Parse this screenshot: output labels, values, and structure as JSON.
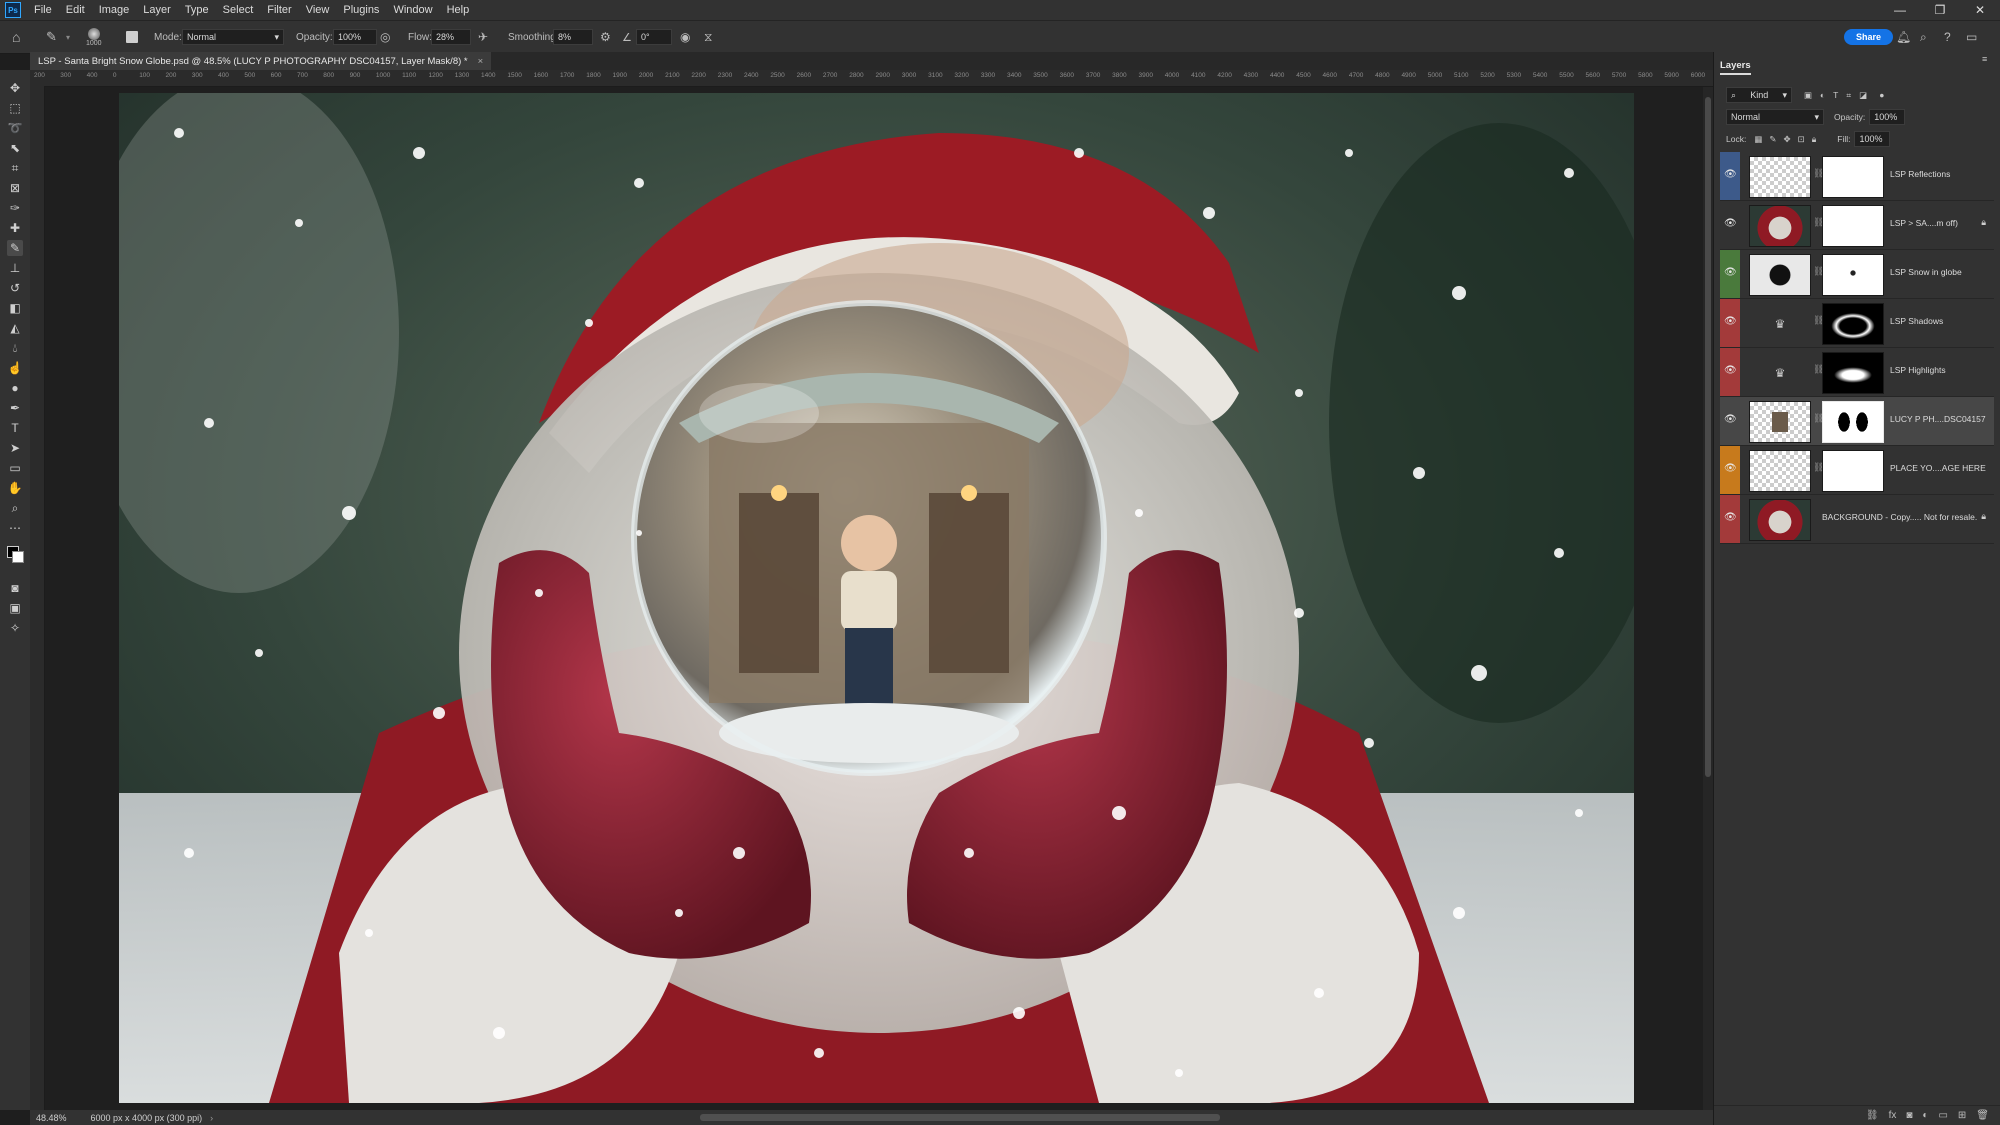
{
  "menu": [
    "File",
    "Edit",
    "Image",
    "Layer",
    "Type",
    "Select",
    "Filter",
    "View",
    "Plugins",
    "Window",
    "Help"
  ],
  "options": {
    "brush_size": "1000",
    "mode_label": "Mode:",
    "mode_value": "Normal",
    "opacity_label": "Opacity:",
    "opacity_value": "100%",
    "flow_label": "Flow:",
    "flow_value": "28%",
    "smoothing_label": "Smoothing:",
    "smoothing_value": "8%",
    "angle_value": "0°",
    "share_label": "Share"
  },
  "document": {
    "tab_title": "LSP - Santa Bright Snow Globe.psd @ 48.5% (LUCY P PHOTOGRAPHY DSC04157, Layer Mask/8) *",
    "close": "×"
  },
  "ruler_numbers": [
    "200",
    "300",
    "400",
    "0",
    "100",
    "200",
    "300",
    "400",
    "500",
    "600",
    "700",
    "800",
    "900",
    "1000",
    "1100",
    "1200",
    "1300",
    "1400",
    "1500",
    "1600",
    "1700",
    "1800",
    "1900",
    "2000",
    "2100",
    "2200",
    "2300",
    "2400",
    "2500",
    "2600",
    "2700",
    "2800",
    "2900",
    "3000",
    "3100",
    "3200",
    "3300",
    "3400",
    "3500",
    "3600",
    "3700",
    "3800",
    "3900",
    "4000",
    "4100",
    "4200",
    "4300",
    "4400",
    "4500",
    "4600",
    "4700",
    "4800",
    "4900",
    "5000",
    "5100",
    "5200",
    "5300",
    "5400",
    "5500",
    "5600",
    "5700",
    "5800",
    "5900",
    "6000"
  ],
  "status": {
    "zoom": "48.48%",
    "doc_info": "6000 px x 4000 px (300 ppi)"
  },
  "layers_panel": {
    "tab": "Layers",
    "filter_label": "Kind",
    "blend_mode": "Normal",
    "opacity_label": "Opacity:",
    "opacity_value": "100%",
    "lock_label": "Lock:",
    "fill_label": "Fill:",
    "fill_value": "100%",
    "layers": [
      {
        "name": "LSP Reflections",
        "color": "#3d5a8a"
      },
      {
        "name": "LSP > SA....m off)",
        "color": ""
      },
      {
        "name": "LSP Snow in globe",
        "color": "#4a7a3c"
      },
      {
        "name": "LSP Shadows",
        "color": "#a33a3a"
      },
      {
        "name": "LSP Highlights",
        "color": "#a33a3a"
      },
      {
        "name": "LUCY P PH....DSC04157",
        "color": ""
      },
      {
        "name": "PLACE YO....AGE HERE",
        "color": "#c77a1c"
      },
      {
        "name": "BACKGROUND - Copy..... Not for resale.",
        "color": "#a33a3a"
      }
    ]
  },
  "colors": {
    "accent": "#1473e6",
    "panel_bg": "#323232",
    "canvas_bg": "#1f1f1f"
  },
  "icons": [
    "home-icon",
    "brush-icon",
    "move-icon",
    "marquee-icon",
    "lasso-icon",
    "crop-icon",
    "eyedropper-icon",
    "healing-icon",
    "stamp-icon",
    "eraser-icon",
    "gradient-icon",
    "pen-icon",
    "type-icon",
    "hand-icon",
    "zoom-icon",
    "eye-icon",
    "lock-icon",
    "link-icon"
  ]
}
